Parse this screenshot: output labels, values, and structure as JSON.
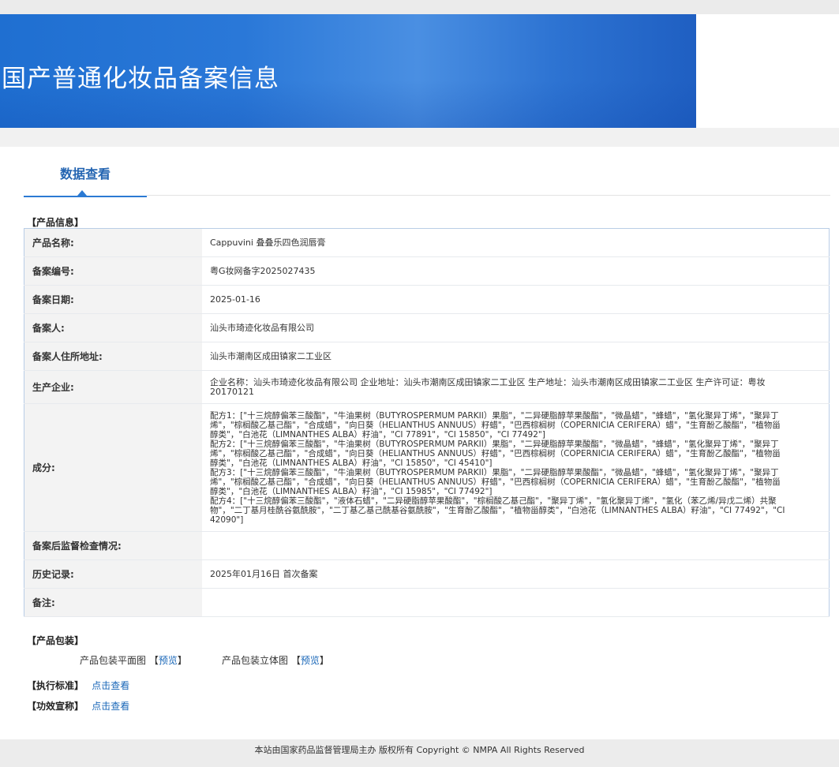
{
  "banner": {
    "title": "国产普通化妆品备案信息"
  },
  "tab": {
    "label": "数据查看"
  },
  "sections": {
    "product_info": "【产品信息】",
    "packaging": "【产品包装】",
    "standard": "【执行标准】",
    "efficacy": "【功效宣称】"
  },
  "product": [
    {
      "label": "产品名称:",
      "value": "Cappuvini 叠叠乐四色润唇膏"
    },
    {
      "label": "备案编号:",
      "value": "粤G妆网备字2025027435"
    },
    {
      "label": "备案日期:",
      "value": "2025-01-16"
    },
    {
      "label": "备案人:",
      "value": "汕头市琦迹化妆品有限公司"
    },
    {
      "label": "备案人住所地址:",
      "value": "汕头市潮南区成田镇家二工业区"
    },
    {
      "label": "生产企业:",
      "value": "企业名称：汕头市琦迹化妆品有限公司 企业地址：汕头市潮南区成田镇家二工业区 生产地址：汕头市潮南区成田镇家二工业区 生产许可证：粤妆20170121"
    },
    {
      "label": "成分:",
      "value": "配方1：[\"十三烷醇偏苯三酸酯\"，\"牛油果树（BUTYROSPERMUM PARKII）果脂\"，\"二异硬脂醇苹果酸酯\"，\"微晶蜡\"，\"蜂蜡\"，\"氢化聚异丁烯\"，\"聚异丁烯\"，\"棕榈酸乙基己酯\"，\"合成蜡\"，\"向日葵（HELIANTHUS ANNUUS）籽蜡\"，\"巴西棕榈树（COPERNICIA CERIFERA）蜡\"，\"生育酚乙酸酯\"，\"植物甾醇类\"，\"白池花（LIMNANTHES ALBA）籽油\"，\"CI 77891\"，\"CI 15850\"，\"CI 77492\"]\n配方2：[\"十三烷醇偏苯三酸酯\"，\"牛油果树（BUTYROSPERMUM PARKII）果脂\"，\"二异硬脂醇苹果酸酯\"，\"微晶蜡\"，\"蜂蜡\"，\"氢化聚异丁烯\"，\"聚异丁烯\"，\"棕榈酸乙基己酯\"，\"合成蜡\"，\"向日葵（HELIANTHUS ANNUUS）籽蜡\"，\"巴西棕榈树（COPERNICIA CERIFERA）蜡\"，\"生育酚乙酸酯\"，\"植物甾醇类\"，\"白池花（LIMNANTHES ALBA）籽油\"，\"CI 15850\"，\"CI 45410\"]\n配方3：[\"十三烷醇偏苯三酸酯\"，\"牛油果树（BUTYROSPERMUM PARKII）果脂\"，\"二异硬脂醇苹果酸酯\"，\"微晶蜡\"，\"蜂蜡\"，\"氢化聚异丁烯\"，\"聚异丁烯\"，\"棕榈酸乙基己酯\"，\"合成蜡\"，\"向日葵（HELIANTHUS ANNUUS）籽蜡\"，\"巴西棕榈树（COPERNICIA CERIFERA）蜡\"，\"生育酚乙酸酯\"，\"植物甾醇类\"，\"白池花（LIMNANTHES ALBA）籽油\"，\"CI 15985\"，\"CI 77492\"]\n配方4：[\"十三烷醇偏苯三酸酯\"，\"液体石蜡\"，\"二异硬脂醇苹果酸酯\"，\"棕榈酸乙基己酯\"，\"聚异丁烯\"，\"氢化聚异丁烯\"，\"氢化（苯乙烯/异戊二烯）共聚物\"，\"二丁基月桂酰谷氨酰胺\"，\"二丁基乙基己酰基谷氨酰胺\"，\"生育酚乙酸酯\"，\"植物甾醇类\"，\"白池花（LIMNANTHES ALBA）籽油\"，\"CI 77492\"，\"CI 42090\"]"
    },
    {
      "label": "备案后监督检查情况:",
      "value": ""
    },
    {
      "label": "历史记录:",
      "value": "2025年01月16日 首次备案"
    },
    {
      "label": "备注:",
      "value": ""
    }
  ],
  "packaging": {
    "flat_label": "产品包装平面图",
    "flat_link": "预览",
    "three_d_label": "产品包装立体图",
    "three_d_link": "预览",
    "bracket_open": "【",
    "bracket_close": "】"
  },
  "standard_link": "点击查看",
  "efficacy_link": "点击查看",
  "footer": {
    "text": "本站由国家药品监督管理局主办 版权所有 Copyright © NMPA All Rights Reserved"
  }
}
